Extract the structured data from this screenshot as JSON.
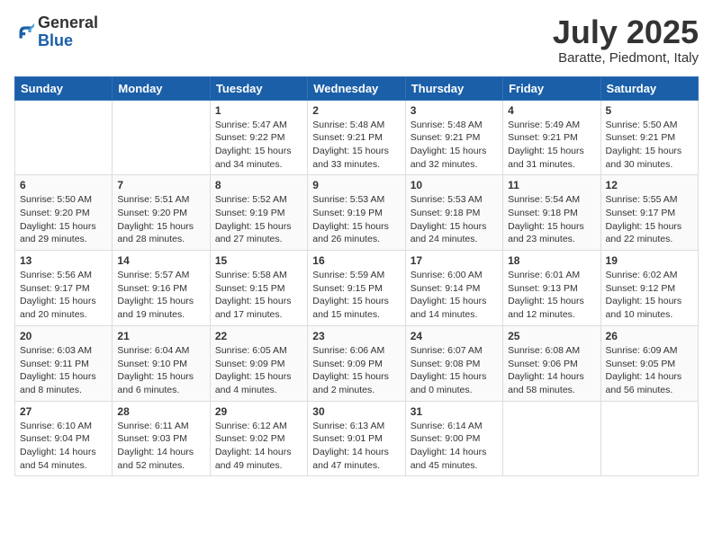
{
  "header": {
    "logo": {
      "general": "General",
      "blue": "Blue"
    },
    "month": "July 2025",
    "location": "Baratte, Piedmont, Italy"
  },
  "weekdays": [
    "Sunday",
    "Monday",
    "Tuesday",
    "Wednesday",
    "Thursday",
    "Friday",
    "Saturday"
  ],
  "weeks": [
    [
      null,
      null,
      {
        "day": "1",
        "sunrise": "Sunrise: 5:47 AM",
        "sunset": "Sunset: 9:22 PM",
        "daylight": "Daylight: 15 hours and 34 minutes."
      },
      {
        "day": "2",
        "sunrise": "Sunrise: 5:48 AM",
        "sunset": "Sunset: 9:21 PM",
        "daylight": "Daylight: 15 hours and 33 minutes."
      },
      {
        "day": "3",
        "sunrise": "Sunrise: 5:48 AM",
        "sunset": "Sunset: 9:21 PM",
        "daylight": "Daylight: 15 hours and 32 minutes."
      },
      {
        "day": "4",
        "sunrise": "Sunrise: 5:49 AM",
        "sunset": "Sunset: 9:21 PM",
        "daylight": "Daylight: 15 hours and 31 minutes."
      },
      {
        "day": "5",
        "sunrise": "Sunrise: 5:50 AM",
        "sunset": "Sunset: 9:21 PM",
        "daylight": "Daylight: 15 hours and 30 minutes."
      }
    ],
    [
      {
        "day": "6",
        "sunrise": "Sunrise: 5:50 AM",
        "sunset": "Sunset: 9:20 PM",
        "daylight": "Daylight: 15 hours and 29 minutes."
      },
      {
        "day": "7",
        "sunrise": "Sunrise: 5:51 AM",
        "sunset": "Sunset: 9:20 PM",
        "daylight": "Daylight: 15 hours and 28 minutes."
      },
      {
        "day": "8",
        "sunrise": "Sunrise: 5:52 AM",
        "sunset": "Sunset: 9:19 PM",
        "daylight": "Daylight: 15 hours and 27 minutes."
      },
      {
        "day": "9",
        "sunrise": "Sunrise: 5:53 AM",
        "sunset": "Sunset: 9:19 PM",
        "daylight": "Daylight: 15 hours and 26 minutes."
      },
      {
        "day": "10",
        "sunrise": "Sunrise: 5:53 AM",
        "sunset": "Sunset: 9:18 PM",
        "daylight": "Daylight: 15 hours and 24 minutes."
      },
      {
        "day": "11",
        "sunrise": "Sunrise: 5:54 AM",
        "sunset": "Sunset: 9:18 PM",
        "daylight": "Daylight: 15 hours and 23 minutes."
      },
      {
        "day": "12",
        "sunrise": "Sunrise: 5:55 AM",
        "sunset": "Sunset: 9:17 PM",
        "daylight": "Daylight: 15 hours and 22 minutes."
      }
    ],
    [
      {
        "day": "13",
        "sunrise": "Sunrise: 5:56 AM",
        "sunset": "Sunset: 9:17 PM",
        "daylight": "Daylight: 15 hours and 20 minutes."
      },
      {
        "day": "14",
        "sunrise": "Sunrise: 5:57 AM",
        "sunset": "Sunset: 9:16 PM",
        "daylight": "Daylight: 15 hours and 19 minutes."
      },
      {
        "day": "15",
        "sunrise": "Sunrise: 5:58 AM",
        "sunset": "Sunset: 9:15 PM",
        "daylight": "Daylight: 15 hours and 17 minutes."
      },
      {
        "day": "16",
        "sunrise": "Sunrise: 5:59 AM",
        "sunset": "Sunset: 9:15 PM",
        "daylight": "Daylight: 15 hours and 15 minutes."
      },
      {
        "day": "17",
        "sunrise": "Sunrise: 6:00 AM",
        "sunset": "Sunset: 9:14 PM",
        "daylight": "Daylight: 15 hours and 14 minutes."
      },
      {
        "day": "18",
        "sunrise": "Sunrise: 6:01 AM",
        "sunset": "Sunset: 9:13 PM",
        "daylight": "Daylight: 15 hours and 12 minutes."
      },
      {
        "day": "19",
        "sunrise": "Sunrise: 6:02 AM",
        "sunset": "Sunset: 9:12 PM",
        "daylight": "Daylight: 15 hours and 10 minutes."
      }
    ],
    [
      {
        "day": "20",
        "sunrise": "Sunrise: 6:03 AM",
        "sunset": "Sunset: 9:11 PM",
        "daylight": "Daylight: 15 hours and 8 minutes."
      },
      {
        "day": "21",
        "sunrise": "Sunrise: 6:04 AM",
        "sunset": "Sunset: 9:10 PM",
        "daylight": "Daylight: 15 hours and 6 minutes."
      },
      {
        "day": "22",
        "sunrise": "Sunrise: 6:05 AM",
        "sunset": "Sunset: 9:09 PM",
        "daylight": "Daylight: 15 hours and 4 minutes."
      },
      {
        "day": "23",
        "sunrise": "Sunrise: 6:06 AM",
        "sunset": "Sunset: 9:09 PM",
        "daylight": "Daylight: 15 hours and 2 minutes."
      },
      {
        "day": "24",
        "sunrise": "Sunrise: 6:07 AM",
        "sunset": "Sunset: 9:08 PM",
        "daylight": "Daylight: 15 hours and 0 minutes."
      },
      {
        "day": "25",
        "sunrise": "Sunrise: 6:08 AM",
        "sunset": "Sunset: 9:06 PM",
        "daylight": "Daylight: 14 hours and 58 minutes."
      },
      {
        "day": "26",
        "sunrise": "Sunrise: 6:09 AM",
        "sunset": "Sunset: 9:05 PM",
        "daylight": "Daylight: 14 hours and 56 minutes."
      }
    ],
    [
      {
        "day": "27",
        "sunrise": "Sunrise: 6:10 AM",
        "sunset": "Sunset: 9:04 PM",
        "daylight": "Daylight: 14 hours and 54 minutes."
      },
      {
        "day": "28",
        "sunrise": "Sunrise: 6:11 AM",
        "sunset": "Sunset: 9:03 PM",
        "daylight": "Daylight: 14 hours and 52 minutes."
      },
      {
        "day": "29",
        "sunrise": "Sunrise: 6:12 AM",
        "sunset": "Sunset: 9:02 PM",
        "daylight": "Daylight: 14 hours and 49 minutes."
      },
      {
        "day": "30",
        "sunrise": "Sunrise: 6:13 AM",
        "sunset": "Sunset: 9:01 PM",
        "daylight": "Daylight: 14 hours and 47 minutes."
      },
      {
        "day": "31",
        "sunrise": "Sunrise: 6:14 AM",
        "sunset": "Sunset: 9:00 PM",
        "daylight": "Daylight: 14 hours and 45 minutes."
      },
      null,
      null
    ]
  ]
}
